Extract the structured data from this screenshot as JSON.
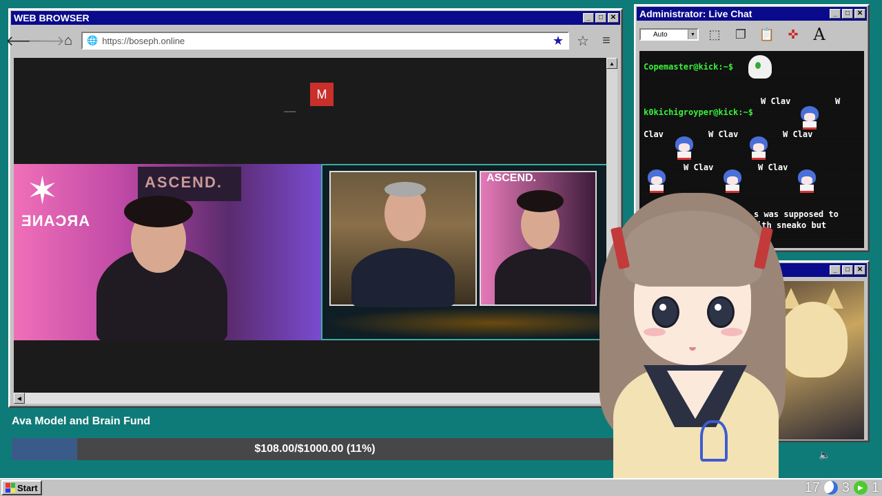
{
  "browser": {
    "title": "WEB BROWSER",
    "url": "https://boseph.online",
    "stream_avatar_letter": "M",
    "feed_banner_left": "ASCEND.",
    "feed_logo": "ARCANE",
    "feed_banner_right": "ASCEND."
  },
  "fund": {
    "title": "Ava Model and Brain Fund",
    "progress_text": "$108.00/$1000.00 (11%)",
    "raised": 108.0,
    "goal": 1000.0,
    "percent": 11,
    "fill_color": "#3a5a8a",
    "track_color": "#474747"
  },
  "chat": {
    "title": "Administrator: Live Chat",
    "font_select": "Auto",
    "prompts": [
      "Copemaster@kick:~$",
      "k0kichigroyper@kick:~$"
    ],
    "messages": [
      "W Clav",
      "W",
      "Clav",
      "W Clav",
      "W Clav",
      "W Clav",
      "W Clav"
    ],
    "partial_text_1": "s was supposed to",
    "partial_text_2": "ith sneako but",
    "prompt_color": "#3bf03b"
  },
  "taskbar": {
    "start_label": "Start",
    "tray_numbers": [
      "17",
      "3",
      "1"
    ]
  },
  "icons": {
    "back": "arrow-left-icon",
    "forward": "arrow-right-icon",
    "home": "home-icon",
    "globe": "globe-icon",
    "bookmark_filled": "star-filled-icon",
    "bookmark_outline": "star-outline-icon",
    "menu": "hamburger-menu-icon"
  }
}
